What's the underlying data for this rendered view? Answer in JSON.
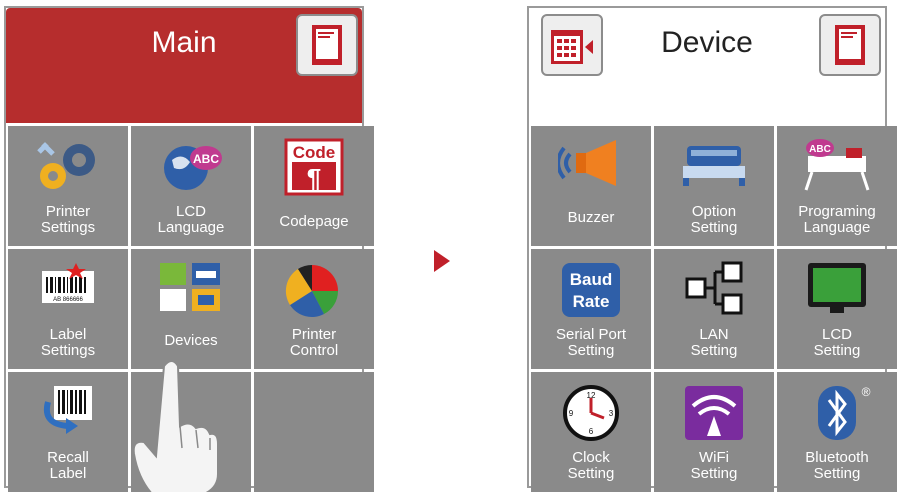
{
  "main": {
    "title": "Main",
    "tiles": [
      {
        "label": "Printer\nSettings",
        "icon": "gears-icon"
      },
      {
        "label": "LCD\nLanguage",
        "icon": "globe-abc-icon"
      },
      {
        "label": "Codepage",
        "icon": "codepage-icon",
        "icon_text": "Code"
      },
      {
        "label": "Label\nSettings",
        "icon": "barcode-label-icon",
        "icon_text": "AB 866666"
      },
      {
        "label": "Devices",
        "icon": "devices-icon"
      },
      {
        "label": "Printer\nControl",
        "icon": "pie-chart-icon"
      },
      {
        "label": "Recall\nLabel",
        "icon": "recall-label-icon"
      },
      {
        "label": "",
        "icon": ""
      },
      {
        "label": "",
        "icon": ""
      }
    ]
  },
  "device": {
    "title": "Device",
    "tiles": [
      {
        "label": "Buzzer",
        "icon": "speaker-icon"
      },
      {
        "label": "Option\nSetting",
        "icon": "option-module-icon"
      },
      {
        "label": "Programing\nLanguage",
        "icon": "printer-abc-icon",
        "icon_text": "ABC"
      },
      {
        "label": "Serial Port\nSetting",
        "icon": "baud-rate-icon",
        "icon_text": "Baud\nRate"
      },
      {
        "label": "LAN\nSetting",
        "icon": "lan-icon"
      },
      {
        "label": "LCD\nSetting",
        "icon": "monitor-icon"
      },
      {
        "label": "Clock\nSetting",
        "icon": "clock-icon",
        "icon_text": "12 3 6 9"
      },
      {
        "label": "WiFi\nSetting",
        "icon": "wifi-icon"
      },
      {
        "label": "Bluetooth\nSetting",
        "icon": "bluetooth-icon",
        "icon_text": "®"
      }
    ]
  },
  "colors": {
    "header_red": "#b62d2d",
    "tile_gray": "#8a8a8a",
    "arrow_red": "#c0202a"
  }
}
